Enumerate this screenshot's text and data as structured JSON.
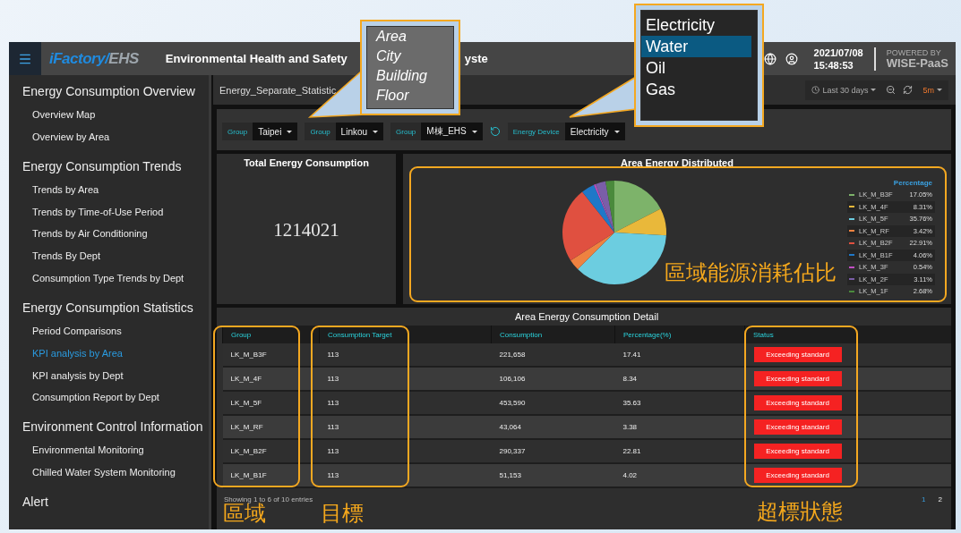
{
  "header": {
    "logo_primary": "iFactory/",
    "logo_secondary": "EHS",
    "title_start": "Environmental Health and Safety",
    "title_end": "yste",
    "date": "2021/07/08",
    "time": "15:48:53",
    "powered_by": "POWERED BY",
    "platform": "WISE-PaaS"
  },
  "sidebar": [
    {
      "title": "Energy Consumption Overview",
      "items": [
        {
          "label": "Overview Map",
          "selected": false
        },
        {
          "label": "Overview by Area",
          "selected": false
        }
      ]
    },
    {
      "title": "Energy Consumption Trends",
      "items": [
        {
          "label": "Trends by Area",
          "selected": false
        },
        {
          "label": "Trends by Time-of-Use Period",
          "selected": false
        },
        {
          "label": "Trends by Air Conditioning",
          "selected": false
        },
        {
          "label": "Trends By Dept",
          "selected": false
        },
        {
          "label": "Consumption Type Trends by Dept",
          "selected": false
        }
      ]
    },
    {
      "title": "Energy Consumption Statistics",
      "items": [
        {
          "label": "Period Comparisons",
          "selected": false
        },
        {
          "label": "KPI analysis by Area",
          "selected": true
        },
        {
          "label": "KPI analysis by Dept",
          "selected": false
        },
        {
          "label": "Consumption Report by Dept",
          "selected": false
        }
      ]
    },
    {
      "title": "Environment Control Information",
      "items": [
        {
          "label": "Environmental Monitoring",
          "selected": false
        },
        {
          "label": "Chilled Water System Monitoring",
          "selected": false
        }
      ]
    },
    {
      "title": "Alert"
    }
  ],
  "page_title": "Energy_Separate_Statistic",
  "time_controls": {
    "range": "Last 30 days",
    "refresh_interval": "5m"
  },
  "filters": [
    {
      "kind": "select",
      "label": "Group",
      "value": "Taipei"
    },
    {
      "kind": "select",
      "label": "Group",
      "value": "Linkou"
    },
    {
      "kind": "select",
      "label": "Group",
      "value": "M棟_EHS"
    },
    {
      "kind": "refresh"
    },
    {
      "kind": "select",
      "label": "Energy Device",
      "value": "Electricity"
    }
  ],
  "total": {
    "title": "Total Energy Consumption",
    "value": "1214021"
  },
  "distribution": {
    "title": "Area Energy Distributed",
    "legend_title": "Percentage",
    "legend": [
      {
        "percentage": "17.05%",
        "color": "#7db36a"
      },
      {
        "percentage": "8.31%",
        "color": "#e9b83a"
      },
      {
        "percentage": "35.76%",
        "color": "#6ccde0"
      },
      {
        "percentage": "3.42%",
        "color": "#ee8240"
      },
      {
        "percentage": "22.91%",
        "color": "#e05040"
      },
      {
        "percentage": "4.06%",
        "color": "#1f78c8"
      },
      {
        "percentage": "0.54%",
        "color": "#c24fc4"
      },
      {
        "percentage": "3.11%",
        "color": "#7a5ea8"
      },
      {
        "percentage": "2.68%",
        "color": "#4a8a3c"
      }
    ],
    "chart_data": {
      "type": "pie",
      "categories": [
        "LK_M_B3F",
        "LK_M_4F",
        "LK_M_5F",
        "LK_M_RF",
        "LK_M_B2F",
        "LK_M_B1F",
        "LK_M_3F",
        "LK_M_2F",
        "LK_M_1F"
      ],
      "values": [
        17.05,
        8.31,
        35.76,
        3.42,
        22.91,
        4.06,
        0.54,
        3.11,
        2.68
      ]
    }
  },
  "table": {
    "title": "Area Energy Consumption Detail",
    "columns": [
      "Group",
      "Consumption Target",
      "Consumption",
      "Percentage(%)",
      "Status"
    ],
    "rows": [
      {
        "cells": [
          "LK_M_B3F",
          "113",
          "221,658",
          "17.41"
        ],
        "status": "Exceeding standard"
      },
      {
        "cells": [
          "LK_M_4F",
          "113",
          "106,106",
          "8.34"
        ],
        "status": "Exceeding standard"
      },
      {
        "cells": [
          "LK_M_5F",
          "113",
          "453,590",
          "35.63"
        ],
        "status": "Exceeding standard"
      },
      {
        "cells": [
          "LK_M_RF",
          "113",
          "43,064",
          "3.38"
        ],
        "status": "Exceeding standard"
      },
      {
        "cells": [
          "LK_M_B2F",
          "113",
          "290,337",
          "22.81"
        ],
        "status": "Exceeding standard"
      },
      {
        "cells": [
          "LK_M_B1F",
          "113",
          "51,153",
          "4.02"
        ],
        "status": "Exceeding standard"
      }
    ],
    "footer": "Showing 1 to 6 of 10 entries",
    "pages": [
      {
        "label": "1",
        "selected": true
      },
      {
        "label": "2",
        "selected": false
      }
    ]
  },
  "callouts": [
    {
      "items": [
        {
          "label": "Area",
          "selected": false
        },
        {
          "label": "City",
          "selected": false
        },
        {
          "label": "Building",
          "selected": false
        },
        {
          "label": "Floor",
          "selected": false
        }
      ]
    },
    {
      "items": [
        {
          "label": "Electricity",
          "selected": false
        },
        {
          "label": "Water",
          "selected": true
        },
        {
          "label": "Oil",
          "selected": false
        },
        {
          "label": "Gas",
          "selected": false
        }
      ]
    }
  ],
  "annotations": [
    "區域能源消耗佔比",
    "區域",
    "目標",
    "超標狀態"
  ]
}
